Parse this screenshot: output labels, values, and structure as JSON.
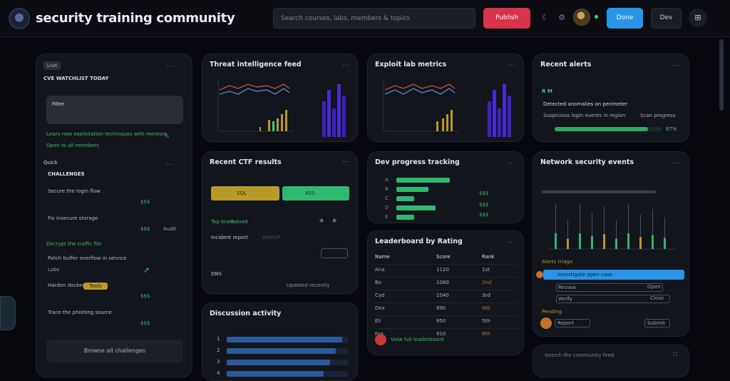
{
  "header": {
    "brand": "security training community",
    "search_placeholder": "Search courses, labs, members & topics",
    "red_button": "Publish",
    "blue_button": "Done",
    "dark_button": "Dev",
    "icons": [
      "logo-shield-icon",
      "moon-icon",
      "settings-icon",
      "avatar",
      "online-dot",
      "grid-icon"
    ]
  },
  "left_panel": {
    "pill": "Live",
    "more": "...",
    "heading": "CVE WATCHLIST TODAY",
    "input_value": "Filter",
    "promo_text": "Learn new exploitation techniques with mentors",
    "promo_sub": "Open to all members",
    "section_label": "Quick",
    "section_more": "...",
    "group_title": "CHALLENGES",
    "items": [
      {
        "label": "Secure the login flow",
        "value": "$$$"
      },
      {
        "label": "Fix insecure storage",
        "value": "$$$"
      },
      {
        "label": "Decrypt the traffic file",
        "value": "$$$"
      },
      {
        "label": "Patch buffer overflow in service",
        "value": "$$$"
      },
      {
        "label": "Harden docker image",
        "value": "$$$"
      },
      {
        "label": "Trace the phishing source",
        "value": "$$$"
      }
    ],
    "side_values": [
      "Audit",
      "Labs",
      "Tools"
    ],
    "footer_button": "Browse all challenges"
  },
  "card1": {
    "title": "Threat intelligence feed",
    "more": "..."
  },
  "card2": {
    "title": "Exploit lab metrics",
    "more": "..."
  },
  "card3": {
    "title": "Recent alerts",
    "more": "...",
    "tag": "R M",
    "line1": "Detected anomalies on perimeter",
    "line2": "Suspicious login events in region",
    "progress_label": "Scan progress",
    "progress_value": "87%",
    "progress": 0.87
  },
  "card4": {
    "title": "Recent CTF results",
    "more": "...",
    "gold_label": "SQL",
    "green_label": "XSS",
    "gold_value": 0.95,
    "green_value": 0.95,
    "legend_a": "Top team",
    "legend_b": "Solved",
    "entry": "Incident report",
    "entry_code": "OWASP",
    "entry_label": "DNS",
    "entry_meta": "Updated recently"
  },
  "card5": {
    "title": "Dev progress tracking",
    "more": "...",
    "bars": [
      {
        "label": "A",
        "value": 0.75
      },
      {
        "label": "B",
        "value": 0.45
      },
      {
        "label": "C",
        "value": 0.25
      },
      {
        "label": "D",
        "value": 0.55
      },
      {
        "label": "E",
        "value": 0.25
      }
    ],
    "values": [
      "$$$",
      "$$$",
      "$$$"
    ]
  },
  "card6": {
    "title": "Leaderboard by Rating",
    "more": "...",
    "rows": [
      [
        "Name",
        "Score",
        "Rank"
      ],
      [
        "Ana",
        "1120",
        "1st"
      ],
      [
        "Bo",
        "1080",
        "2nd"
      ],
      [
        "Cyd",
        "1040",
        "3rd"
      ],
      [
        "Dex",
        "990",
        "4th"
      ],
      [
        "Eli",
        "950",
        "5th"
      ],
      [
        "Fox",
        "910",
        "6th"
      ]
    ],
    "footer": "View full leaderboard"
  },
  "card7": {
    "title": "Network security events",
    "more": "...",
    "bars": [
      0.85,
      0.55,
      0.85,
      0.7,
      0.8,
      0.55,
      0.85,
      0.65,
      0.75,
      0.6
    ],
    "label": "Alerts triage",
    "items": [
      {
        "label": "Investigate open case",
        "value": ""
      },
      {
        "label": "Review",
        "value": "Open"
      },
      {
        "label": "Verify",
        "value": "Close"
      }
    ],
    "pending": "Pending",
    "final_label": "Report",
    "final_value": "Submit"
  },
  "card8": {
    "title": "Discussion activity",
    "items": [
      {
        "num": "1",
        "fill": 0.95
      },
      {
        "num": "2",
        "fill": 0.9
      },
      {
        "num": "3",
        "fill": 0.85
      },
      {
        "num": "4",
        "fill": 0.8
      }
    ]
  },
  "bottom_search": "Search the community feed",
  "colors": {
    "accent_blue": "#2a95e8",
    "accent_red": "#d8334a",
    "green": "#35d07f",
    "gold": "#b89a2a",
    "purple": "#4a2ad0"
  }
}
